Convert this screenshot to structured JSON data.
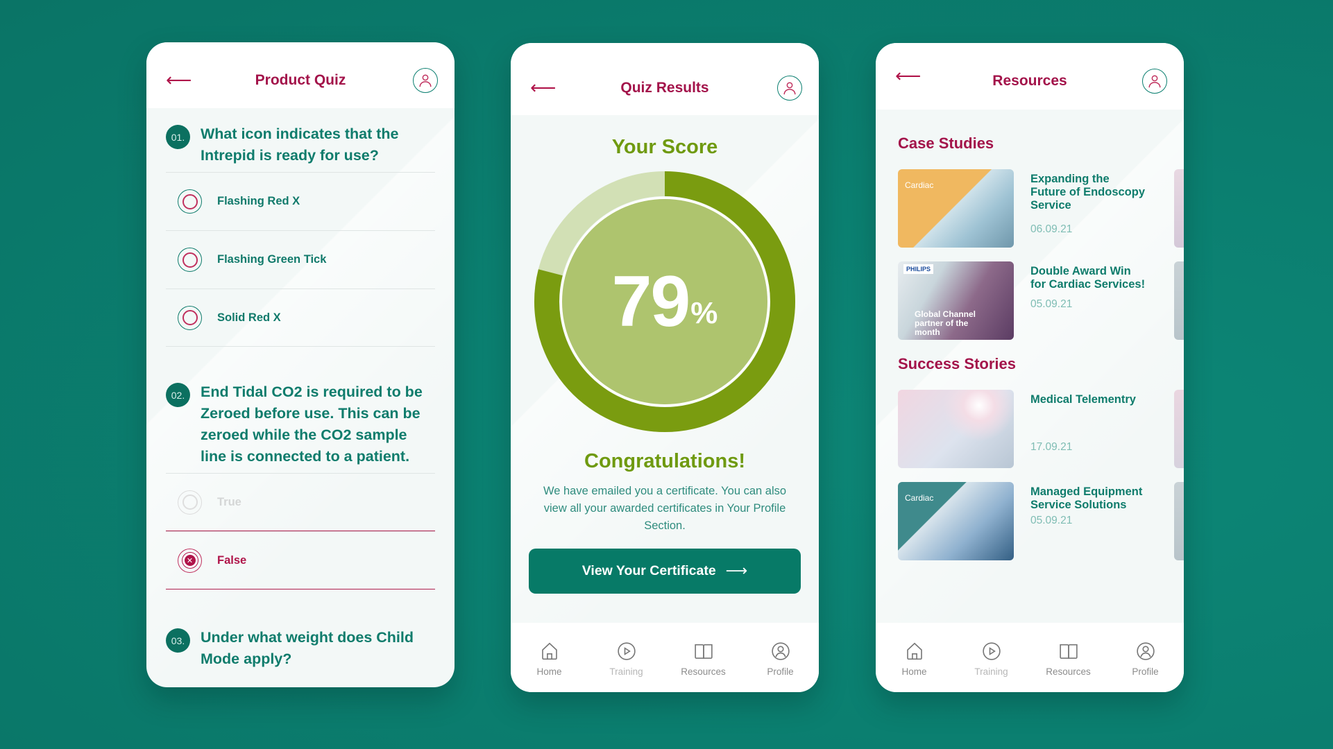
{
  "colors": {
    "background": "#0b7f70",
    "brand_crimson": "#a3134a",
    "brand_teal": "#0f7c6c",
    "score_green": "#7a9c10",
    "score_green_light": "#d2e0b5",
    "score_fill": "#aec46e",
    "button_teal": "#077a67"
  },
  "quiz": {
    "title": "Product Quiz",
    "back_icon": "arrow-left-icon",
    "avatar_icon": "user-icon",
    "questions": [
      {
        "number": "01.",
        "text": "What icon indicates that the Intrepid is ready for use?",
        "options": [
          {
            "label": "Flashing Red X",
            "state": "unselected"
          },
          {
            "label": "Flashing Green Tick",
            "state": "unselected"
          },
          {
            "label": "Solid Red X",
            "state": "unselected"
          }
        ]
      },
      {
        "number": "02.",
        "text": "End Tidal CO2 is required to be Zeroed before use. This can be zeroed while the CO2 sample line is connected to a patient.",
        "options": [
          {
            "label": "True",
            "state": "disabled"
          },
          {
            "label": "False",
            "state": "selected-wrong"
          }
        ]
      },
      {
        "number": "03.",
        "text": "Under what weight does Child Mode apply?",
        "options": []
      }
    ]
  },
  "results": {
    "title": "Quiz Results",
    "score_title": "Your Score",
    "score_value": "79",
    "score_unit": "%",
    "score_fraction": 0.79,
    "congrats_title": "Congratulations!",
    "congrats_message": "We have emailed you a certificate. You can also view all your awarded certificates in Your Profile Section.",
    "certificate_button": "View Your Certificate",
    "certificate_arrow": "⟶"
  },
  "resources": {
    "title": "Resources",
    "sections": [
      {
        "title": "Case Studies",
        "items": [
          {
            "title": "Expanding the Future of Endoscopy Service",
            "date": "06.09.21",
            "thumb_caption": "Cardiac"
          },
          {
            "title": "Double Award Win for Cardiac Services!",
            "date": "05.09.21",
            "thumb_caption": "Global Channel partner of the month",
            "thumb_brand": "PHILIPS"
          }
        ]
      },
      {
        "title": "Success Stories",
        "items": [
          {
            "title": "Medical Telementry",
            "date": "17.09.21"
          },
          {
            "title": "Managed Equipment Service Solutions",
            "date": "05.09.21",
            "thumb_caption": "Cardiac"
          }
        ]
      }
    ]
  },
  "bottom_nav": [
    {
      "label": "Home",
      "icon": "home-icon"
    },
    {
      "label": "Training",
      "icon": "play-circle-icon"
    },
    {
      "label": "Resources",
      "icon": "book-icon"
    },
    {
      "label": "Profile",
      "icon": "profile-icon"
    }
  ]
}
